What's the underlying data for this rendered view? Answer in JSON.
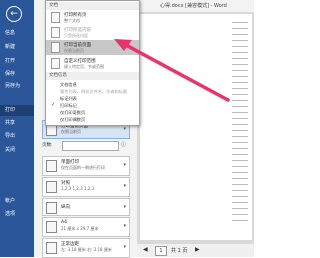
{
  "titlebar": {
    "title": "心得.docx [兼容模式] - Word"
  },
  "sidebar": {
    "items": [
      {
        "label": "信息",
        "selected": false
      },
      {
        "label": "新建",
        "selected": false
      },
      {
        "label": "打开",
        "selected": false
      },
      {
        "label": "保存",
        "selected": false
      },
      {
        "label": "另存为",
        "selected": false
      },
      {
        "label": "打印",
        "selected": true
      },
      {
        "label": "共享",
        "selected": false
      },
      {
        "label": "导出",
        "selected": false
      },
      {
        "label": "关闭",
        "selected": false
      },
      {
        "label": "帐户",
        "selected": false
      },
      {
        "label": "选项",
        "selected": false
      }
    ],
    "accent": "#2b579a"
  },
  "menu": {
    "section_document": "文档",
    "items": [
      {
        "title": "打印所有页",
        "sub": "整个文档"
      },
      {
        "title": "打印所选内容",
        "sub": "只是所选内容"
      },
      {
        "title": "打印当前页面",
        "sub": "仅限当前页"
      },
      {
        "title": "自定义打印范围",
        "sub": "键入特定页、节或范围"
      }
    ],
    "section_info": "文档信息",
    "options": [
      {
        "label": "文档信息",
        "enabled": true,
        "checked": false
      },
      {
        "label": "属性列表，例如文件名、作者和标题",
        "enabled": false,
        "checked": false
      },
      {
        "label": "标记列表",
        "enabled": true,
        "checked": false
      },
      {
        "label": "打印标记",
        "enabled": true,
        "checked": true
      },
      {
        "label": "仅打印奇数页",
        "enabled": true,
        "checked": false
      },
      {
        "label": "仅打印偶数页",
        "enabled": true,
        "checked": false
      }
    ]
  },
  "settings": {
    "range": {
      "title": "打印当前页面",
      "sub": "仅限当前页"
    },
    "pages_label": "页数:",
    "sides": {
      "title": "单面打印",
      "sub": "仅在页面的一侧进行打印"
    },
    "collate": {
      "title": "对照",
      "sub": "1,2,3   1,2,3   1,2,3"
    },
    "orientation": {
      "title": "纵向"
    },
    "paper": {
      "title": "A4",
      "sub": "21 厘米 x 29.7 厘米"
    },
    "margins": {
      "title": "正常边距",
      "sub": "左: 3.18 厘米  右: 3.18 厘米"
    }
  },
  "pager": {
    "current": "1",
    "total": "共 1 页"
  },
  "arrow_color": "#e8336b"
}
